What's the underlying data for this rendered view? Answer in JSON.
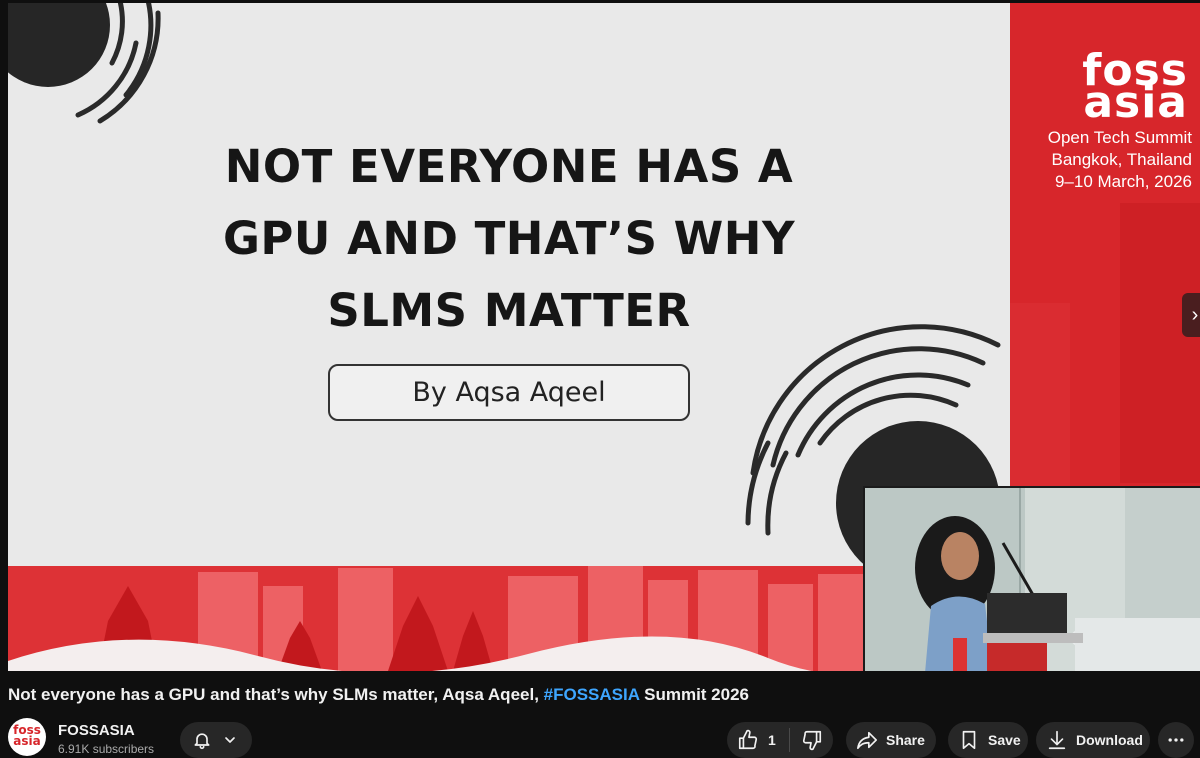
{
  "slide": {
    "title_lines": [
      "NOT EVERYONE HAS A",
      "GPU AND THAT’S WHY",
      "SLMS MATTER"
    ],
    "byline": "By Aqsa Aqeel"
  },
  "sidebar": {
    "logo_lines": [
      "foss",
      "asia"
    ],
    "event_lines": [
      "Open Tech Summit",
      "Bangkok, Thailand",
      "9–10 March, 2026"
    ]
  },
  "player": {
    "next_icon": "chevron-right-icon"
  },
  "video": {
    "title_before": "Not everyone has a GPU and that’s why SLMs matter, Aqsa Aqeel, ",
    "hashtag": "#FOSSASIA",
    "title_after": " Summit 2026"
  },
  "channel": {
    "avatar_lines": [
      "foss",
      "asia"
    ],
    "name": "FOSSASIA",
    "subscribers": "6.91K subscribers"
  },
  "actions": {
    "like_count": "1",
    "share_label": "Share",
    "save_label": "Save",
    "download_label": "Download"
  },
  "colors": {
    "brand_red": "#d7262b",
    "link_blue": "#3ea6ff",
    "pill_bg": "#272727"
  }
}
